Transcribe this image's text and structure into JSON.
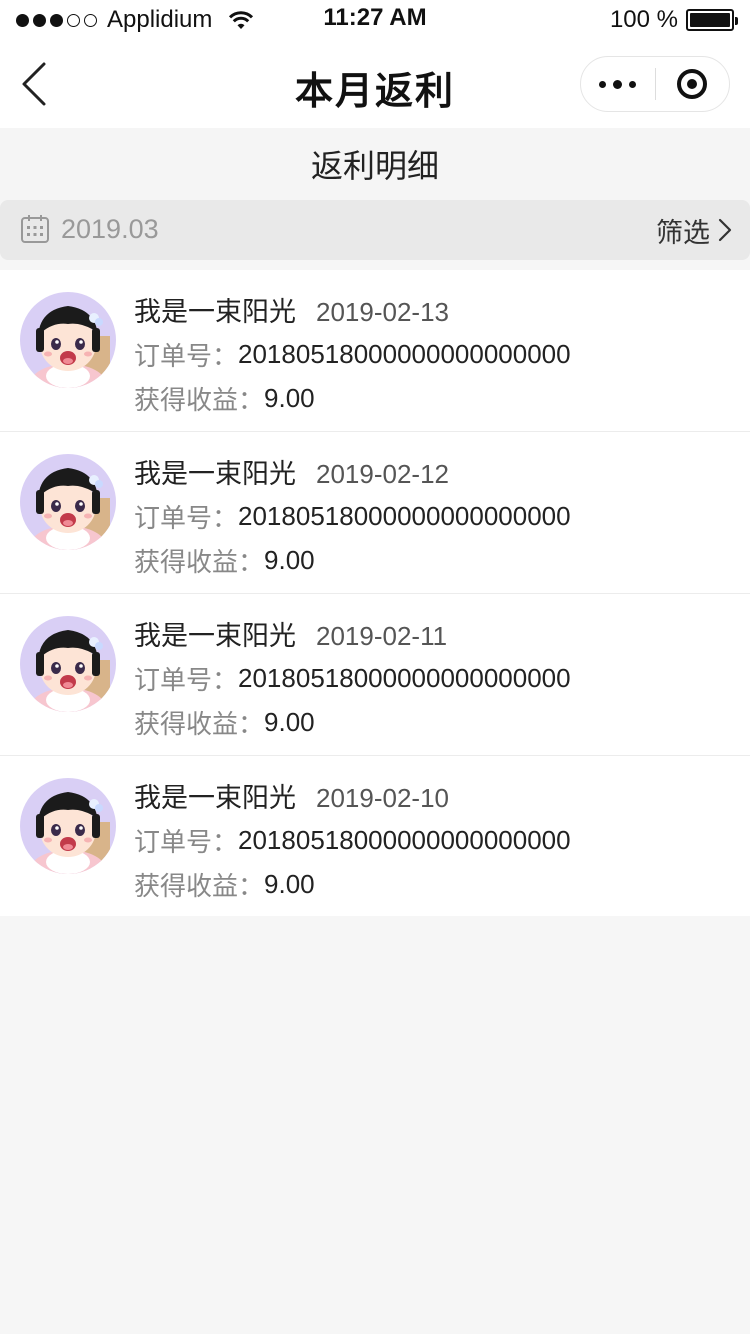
{
  "status_bar": {
    "carrier": "Applidium",
    "time": "11:27 AM",
    "battery": "100 %",
    "battery_level": 1.0
  },
  "nav": {
    "title": "本月返利"
  },
  "section": {
    "title": "返利明细"
  },
  "filter_bar": {
    "month": "2019.03",
    "filter_label": "筛选"
  },
  "records": [
    {
      "name": "我是一束阳光",
      "date": "2019-02-13",
      "order_label": "订单号：",
      "order_no": "20180518000000000000000",
      "income_label": "获得收益：",
      "income": "9.00"
    },
    {
      "name": "我是一束阳光",
      "date": "2019-02-12",
      "order_label": "订单号：",
      "order_no": "20180518000000000000000",
      "income_label": "获得收益：",
      "income": "9.00"
    },
    {
      "name": "我是一束阳光",
      "date": "2019-02-11",
      "order_label": "订单号：",
      "order_no": "20180518000000000000000",
      "income_label": "获得收益：",
      "income": "9.00"
    },
    {
      "name": "我是一束阳光",
      "date": "2019-02-10",
      "order_label": "订单号：",
      "order_no": "20180518000000000000000",
      "income_label": "获得收益：",
      "income": "9.00"
    }
  ],
  "colors": {
    "background": "#f6f6f6",
    "filter_bar": "#e9e9e9",
    "avatar_bg": "#d9cff5"
  }
}
